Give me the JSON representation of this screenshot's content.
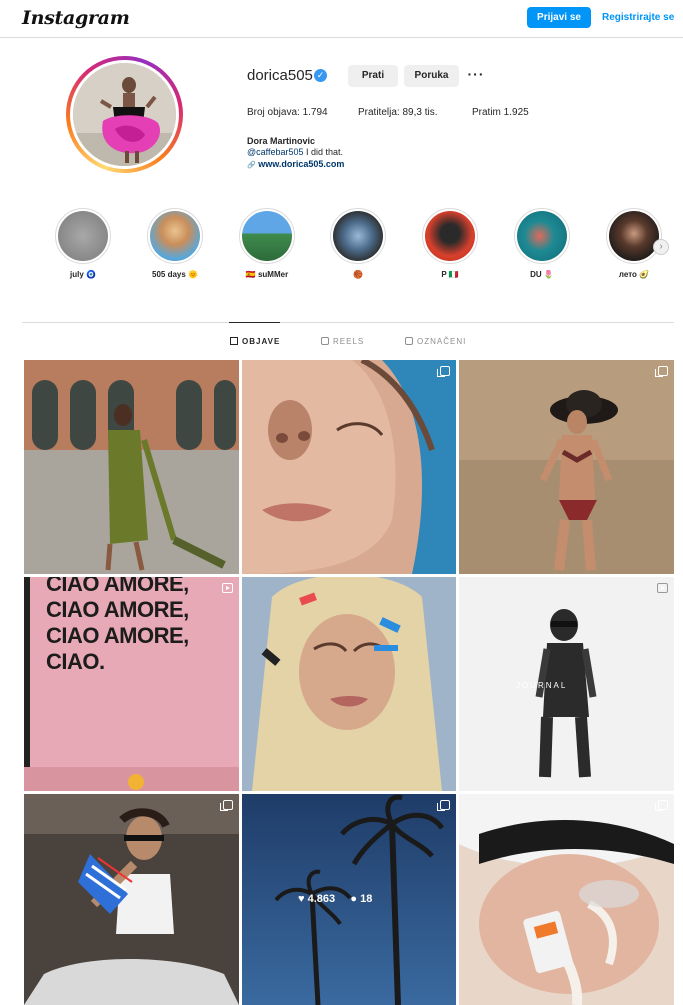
{
  "header": {
    "logo": "Instagram",
    "login_label": "Prijavi se",
    "register_label": "Registrirajte se"
  },
  "profile": {
    "username": "dorica505",
    "verified_icon": "✓",
    "follow_label": "Prati",
    "message_label": "Poruka",
    "more_label": "···",
    "stats": {
      "posts": "Broj objava: 1.794",
      "followers": "Pratitelja: 89,3 tis.",
      "following": "Pratim 1.925"
    },
    "full_name": "Dora Martinovic",
    "bio_mention": "@caffebar505",
    "bio_text": " I did that.",
    "link_icon": "🔗",
    "link": "www.dorica505.com"
  },
  "highlights": [
    {
      "label": "july 🧿"
    },
    {
      "label": "505 days 🌞"
    },
    {
      "label": "🇪🇸 suMMer"
    },
    {
      "label": "🏀"
    },
    {
      "label": "P 🇮🇹"
    },
    {
      "label": "DU 🌷"
    },
    {
      "label": "лето 🥑"
    }
  ],
  "tabs": [
    {
      "label": "OBJAVE",
      "icon": "grid-icon",
      "active": true
    },
    {
      "label": "REELS",
      "icon": "reels-icon",
      "active": false
    },
    {
      "label": "OZNAČENI",
      "icon": "tagged-icon",
      "active": false
    }
  ],
  "posts": {
    "poster_text": "CIAO AMORE,\nCIAO AMORE,\nCIAO AMORE,\nCIAO.",
    "journal_text": "JOURNAL",
    "hover_likes": "4.863",
    "hover_comments": "18"
  },
  "colors": {
    "accent": "#0095f6",
    "link": "#00376b"
  }
}
